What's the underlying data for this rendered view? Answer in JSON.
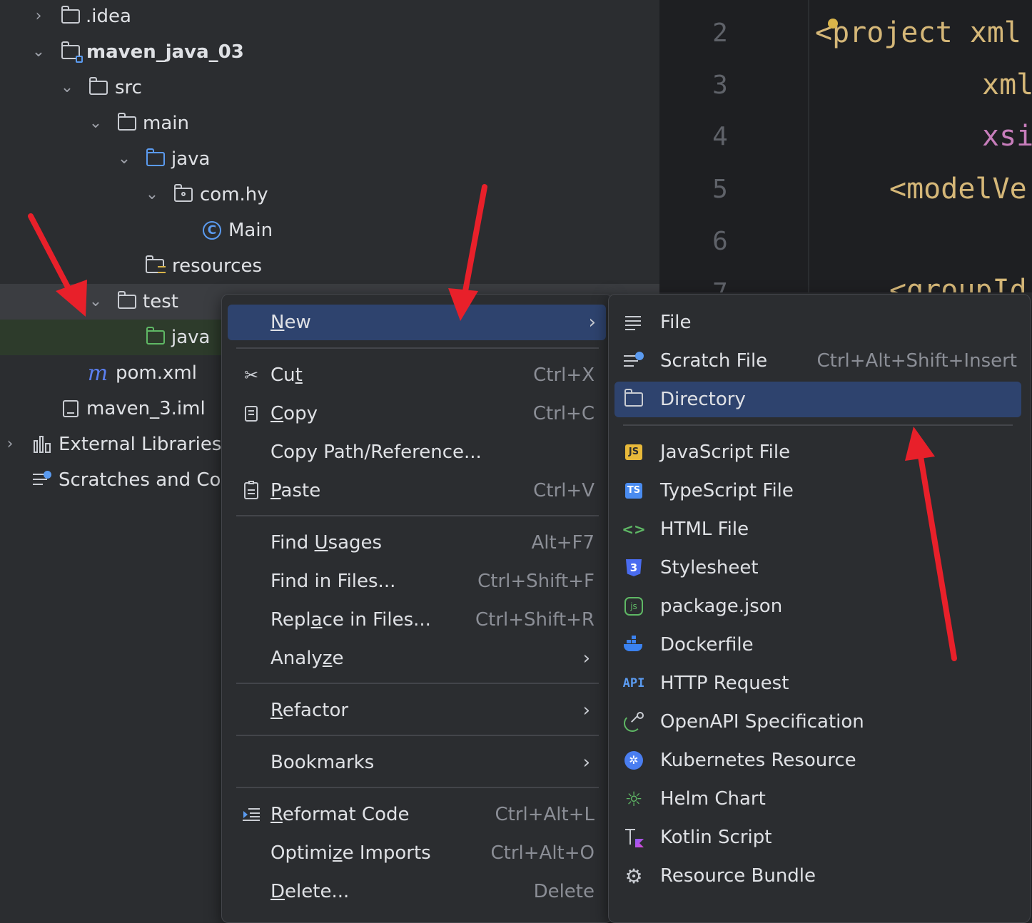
{
  "tree": {
    "items": [
      {
        "label": ".idea"
      },
      {
        "label": "maven_java_03"
      },
      {
        "label": "src"
      },
      {
        "label": "main"
      },
      {
        "label": "java"
      },
      {
        "label": "com.hy"
      },
      {
        "label": "Main"
      },
      {
        "label": "resources"
      },
      {
        "label": "test"
      },
      {
        "label": "java"
      },
      {
        "label": "pom.xml"
      },
      {
        "label": "maven_3.iml"
      },
      {
        "label": "External Libraries"
      },
      {
        "label": "Scratches and Co"
      }
    ]
  },
  "editor": {
    "line_numbers": [
      "2",
      "3",
      "4",
      "5",
      "6",
      "7"
    ],
    "lines": [
      "<project xml",
      "xml",
      "xsi",
      "<modelVe",
      "",
      "<groupId"
    ]
  },
  "context_menu": {
    "new": {
      "pre": "",
      "u": "N",
      "post": "ew"
    },
    "cut": {
      "pre": "Cu",
      "u": "t",
      "post": "",
      "shortcut": "Ctrl+X"
    },
    "copy": {
      "pre": "",
      "u": "C",
      "post": "opy",
      "shortcut": "Ctrl+C"
    },
    "copy_path": {
      "label": "Copy Path/Reference..."
    },
    "paste": {
      "pre": "",
      "u": "P",
      "post": "aste",
      "shortcut": "Ctrl+V"
    },
    "find_usages": {
      "pre": "Find ",
      "u": "U",
      "post": "sages",
      "shortcut": "Alt+F7"
    },
    "find_in_files": {
      "label": "Find in Files...",
      "shortcut": "Ctrl+Shift+F"
    },
    "replace_in_files": {
      "pre": "Repl",
      "u": "a",
      "post": "ce in Files...",
      "shortcut": "Ctrl+Shift+R"
    },
    "analyze": {
      "pre": "Analy",
      "u": "z",
      "post": "e"
    },
    "refactor": {
      "pre": "",
      "u": "R",
      "post": "efactor"
    },
    "bookmarks": {
      "label": "Bookmarks"
    },
    "reformat": {
      "pre": "",
      "u": "R",
      "post": "eformat Code",
      "shortcut": "Ctrl+Alt+L"
    },
    "optimize": {
      "pre": "Optimi",
      "u": "z",
      "post": "e Imports",
      "shortcut": "Ctrl+Alt+O"
    },
    "delete": {
      "pre": "",
      "u": "D",
      "post": "elete...",
      "shortcut": "Delete"
    }
  },
  "new_submenu": {
    "file": {
      "label": "File"
    },
    "scratch": {
      "label": "Scratch File",
      "shortcut": "Ctrl+Alt+Shift+Insert"
    },
    "directory": {
      "label": "Directory"
    },
    "js": {
      "label": "JavaScript File",
      "icon_text": "JS"
    },
    "ts": {
      "label": "TypeScript File",
      "icon_text": "TS"
    },
    "html": {
      "label": "HTML File",
      "icon_text": "<>"
    },
    "stylesheet": {
      "label": "Stylesheet"
    },
    "package_json": {
      "label": "package.json"
    },
    "dockerfile": {
      "label": "Dockerfile"
    },
    "http": {
      "label": "HTTP Request",
      "icon_text": "API"
    },
    "openapi": {
      "label": "OpenAPI Specification"
    },
    "kubernetes": {
      "label": "Kubernetes Resource"
    },
    "helm": {
      "label": "Helm Chart"
    },
    "kotlin": {
      "label": "Kotlin Script"
    },
    "bundle": {
      "label": "Resource Bundle"
    }
  },
  "colors": {
    "menu_highlight": "#2e436e",
    "annotation_arrow": "#e8202a",
    "selected_row": "#2d3b2b"
  }
}
